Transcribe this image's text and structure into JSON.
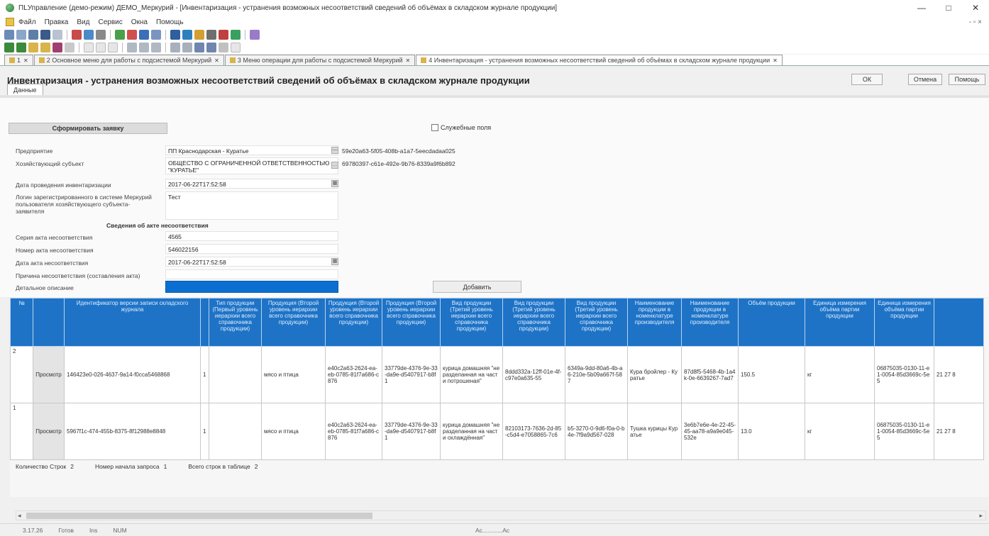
{
  "window": {
    "title": "ПLУправление (демо-режим) ДЕМО_Меркурий - [Инвентаризация - устранения возможных несоответствий сведений об объёмах в складском журнале продукции]",
    "controls": [
      "—",
      "□",
      "✕"
    ]
  },
  "menu": {
    "items": [
      "Файл",
      "Правка",
      "Вид",
      "Сервис",
      "Окна",
      "Помощь"
    ],
    "mdi_controls": "- ▫ ×"
  },
  "doc_tabs": [
    {
      "label": "1"
    },
    {
      "label": "2 Основное меню для работы с подсистемой Меркурий"
    },
    {
      "label": "3 Меню операции для работы с подсистемой Меркурий"
    },
    {
      "label": "4 Инвентаризация - устранения возможных несоответствий сведений об объёмах в складском журнале продукции"
    }
  ],
  "page": {
    "title": "Инвентаризация - устранения возможных несоответствий сведений об объёмах в складском журнале продукции",
    "ok_label": "ОК",
    "cancel_label": "Отмена",
    "help_label": "Помощь",
    "panel_tab": "Данные"
  },
  "form": {
    "generate_button": "Сформировать заявку",
    "service_fields_label": "Служебные поля",
    "fields": {
      "enterprise": {
        "label": "Предприятие",
        "value": "ПП Краснодарская - Куратье",
        "guid": "59e20a63-5f05-408b-a1a7-5eecdadaa025"
      },
      "business_entity": {
        "label": "Хозяйствующий субъект",
        "value": "ОБЩЕСТВО С ОГРАНИЧЕННОЙ ОТВЕТСТВЕННОСТЬЮ \"КУРАТЬЕ\"",
        "guid": "69780397-c61e-492e-9b76-8339a9f6b892"
      },
      "inventory_date": {
        "label": "Дата проведения инвентаризации",
        "value": "2017-06-22T17:52:58"
      },
      "user_login": {
        "label": "Логин зарегистрированного в системе Меркурий пользователя хозяйствующего субъекта-заявителя",
        "value": "Тест"
      },
      "section_title": "Сведения об акте несоответствия",
      "act_series": {
        "label": "Серия акта несоответствия",
        "value": "4565"
      },
      "act_number": {
        "label": "Номер акта несоответствия",
        "value": "546022156"
      },
      "act_date": {
        "label": "Дата акта несоответствия",
        "value": "2017-06-22T17:52:58"
      },
      "act_reason": {
        "label": "Причина несоответствия (составления акта)",
        "value": ""
      },
      "detail": {
        "label": "Детальное описание",
        "value": ""
      }
    },
    "add_button": "Добавить"
  },
  "table": {
    "headers": [
      "№",
      "",
      "Идентификатор версии записи складского журнала",
      "Тип продукции (Первый уровень иерархии всего справочника продукции)",
      "Продукция (Второй уровень иерархии всего справочника продукции)",
      "Продукция (Второй уровень иерархии всего справочника продукции)",
      "Продукция (Второй уровень иерархии всего справочника продукции)",
      "Вид продукции (Третий уровень иерархии всего справочника продукции)",
      "Вид продукции (Третий уровень иерархии всего справочника продукции)",
      "Вид продукции (Третий уровень иерархии всего справочника продукции)",
      "Наименование продукции в номенклатуре производителя",
      "Наименование продукции в номенклатуре производителя",
      "Объём продукции",
      "Единица измерения объёма партии продукции",
      "Единица измерения объёма партии продукции",
      ""
    ],
    "rows": [
      {
        "num": "2",
        "view": "Просмотр",
        "record_id": "146423e0-026-4637-9a14-f0cca5468868",
        "row_marker": "1",
        "product_type": "мясо и птица",
        "product_guid": "e40c2a63-2624-ea-eb-0785-81f7a686-c876",
        "product_guid2": "33779de-4376-9e-33-da9e-d5407917-b8f1",
        "subproduct": "курица домашняя \"не разделанная на части потрошеная\"",
        "subproduct_guid": "8ddd332a-12ff-01e-4f-c97e0a635-55",
        "subproduct_guid2": "6349a-9dd-80a6-4b-a6-210e-5b09a667f-587",
        "producer_name": "Кура бройлер - Куратье",
        "producer_guid": "87d8f5-5468-4b-1a4k-0e-6639267-7ad7",
        "volume": "150.5",
        "unit": "кг",
        "unit_guid": "06875035-0130-11-e1-0054-85d3669c-5e5",
        "extra": "21 27 8"
      },
      {
        "num": "1",
        "view": "Просмотр",
        "record_id": "5967f1c-474-455b-8375-8f12988e8848",
        "row_marker": "1",
        "product_type": "мясо и птица",
        "product_guid": "e40c2a63-2624-ea-eb-0785-81f7a686-c876",
        "product_guid2": "33779de-4376-9e-33-da9e-d5407917-b8f1",
        "subproduct": "курица домашняя \"не разделанная на части охлаждённая\"",
        "subproduct_guid": "82103173-7636-2d-85-c5d4-e7058865-7c6",
        "subproduct_guid2": "b5-3270-0-9d6-f0a-0-b4e-7f9a9d567-028",
        "producer_name": "Тушка курицы Куратье",
        "producer_guid": "3e6b7e6e-4e-22-45-45-aa78-a9a9e045-532e",
        "volume": "13.0",
        "unit": "кг",
        "unit_guid": "06875035-0130-11-e1-0054-85d3669c-5e5",
        "extra": "21 27 8"
      }
    ]
  },
  "footer": {
    "row_count_label": "Количество Строк",
    "row_count": "2",
    "request_start_label": "Номер начала запроса",
    "request_start": "1",
    "total_rows_label": "Всего строк в таблице",
    "total_rows": "2"
  },
  "status": {
    "left": "3.17.26",
    "a": "Готов",
    "b": "Ins",
    "c": "NUM",
    "center": "Ac............Ac"
  }
}
